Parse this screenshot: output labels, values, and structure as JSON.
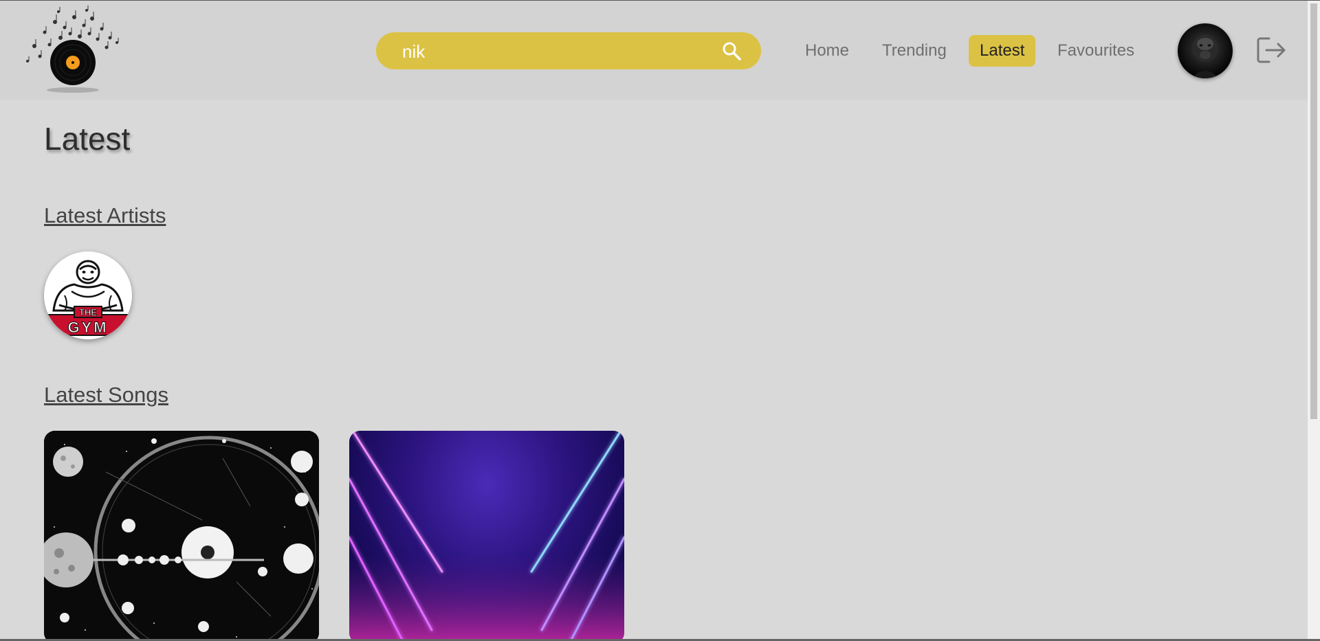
{
  "search": {
    "value": "nik"
  },
  "nav": {
    "items": [
      {
        "label": "Home"
      },
      {
        "label": "Trending"
      },
      {
        "label": "Latest"
      },
      {
        "label": "Favourites"
      }
    ],
    "active": "Latest"
  },
  "icons": {
    "search": "search-icon",
    "logout": "logout-icon",
    "logo": "vinyl-logo-icon"
  },
  "colors": {
    "accent": "#dcc244",
    "background": "#d9d9d9",
    "header": "#d3d3d3"
  },
  "main": {
    "title": "Latest",
    "artists_heading": "Latest Artists",
    "songs_heading": "Latest Songs",
    "artists": [
      {
        "logo_text": "THE GYM"
      }
    ]
  }
}
